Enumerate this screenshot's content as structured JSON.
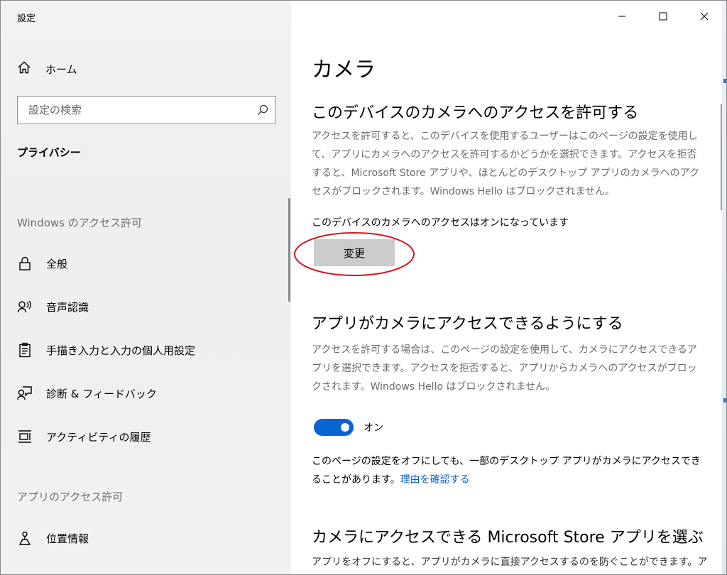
{
  "window": {
    "title": "設定",
    "controls": {
      "minimize": "minimize",
      "maximize": "maximize",
      "close": "close"
    }
  },
  "nav": {
    "home_label": "ホーム",
    "search_placeholder": "設定の検索",
    "section_title": "プライバシー",
    "group_windows": "Windows のアクセス許可",
    "group_apps": "アプリのアクセス許可",
    "items": [
      {
        "label": "全般",
        "icon": "lock-icon"
      },
      {
        "label": "音声認識",
        "icon": "speech-icon"
      },
      {
        "label": "手描き入力と入力の個人用設定",
        "icon": "clipboard-icon"
      },
      {
        "label": "診断 & フィードバック",
        "icon": "feedback-icon"
      },
      {
        "label": "アクティビティの履歴",
        "icon": "timeline-icon"
      }
    ],
    "app_items": [
      {
        "label": "位置情報",
        "icon": "location-icon"
      }
    ]
  },
  "main": {
    "title": "カメラ",
    "section1": {
      "heading": "このデバイスのカメラへのアクセスを許可する",
      "description": "アクセスを許可すると、このデバイスを使用するユーザーはこのページの設定を使用して、アプリにカメラへのアクセスを許可するかどうかを選択できます。アクセスを拒否すると、Microsoft Store アプリや、ほとんどのデスクトップ アプリのカメラへのアクセスがブロックされます。Windows Hello はブロックされません。",
      "status": "このデバイスのカメラへのアクセスはオンになっています",
      "button_label": "変更"
    },
    "section2": {
      "heading": "アプリがカメラにアクセスできるようにする",
      "description": "アクセスを許可する場合は、このページの設定を使用して、カメラにアクセスできるアプリを選択できます。アクセスを拒否すると、アプリからカメラへのアクセスがブロックされます。Windows Hello はブロックされません。",
      "toggle_state": "オン",
      "note_text": "このページの設定をオフにしても、一部のデスクトップ アプリがカメラにアクセスできることがあります。",
      "note_link": "理由を確認する"
    },
    "section3": {
      "heading": "カメラにアクセスできる Microsoft Store アプリを選ぶ",
      "description": "アプリをオフにすると、アプリがカメラに直接アクセスするのを防ぐことができます。ア"
    }
  },
  "colors": {
    "accent": "#0a63d4",
    "link": "#0a5fc4",
    "annotation": "#d8141c"
  }
}
